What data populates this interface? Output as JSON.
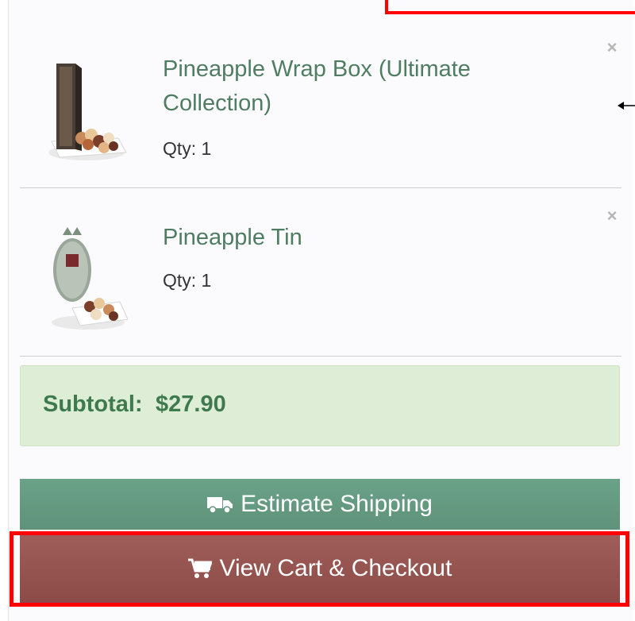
{
  "cart": {
    "items": [
      {
        "name": "Pineapple Wrap Box (Ultimate Collection)",
        "qty": "Qty: 1",
        "remove": "×",
        "image_icon": "wrap-box-product-image"
      },
      {
        "name": "Pineapple Tin",
        "qty": "Qty: 1",
        "remove": "×",
        "image_icon": "tin-product-image"
      }
    ],
    "subtotal_label": "Subtotal:",
    "subtotal_value": "$27.90",
    "estimate_shipping_label": "Estimate Shipping",
    "estimate_shipping_icon": "truck-icon",
    "checkout_label": "View Cart & Checkout",
    "checkout_icon": "cart-icon"
  },
  "colors": {
    "item_name": "#4f7d62",
    "subtotal_bg": "#deeed6",
    "subtotal_text": "#3f7a4f",
    "shipping_button": "#6aa288",
    "checkout_button": "#9f5e5a",
    "highlight": "#ff0000"
  }
}
